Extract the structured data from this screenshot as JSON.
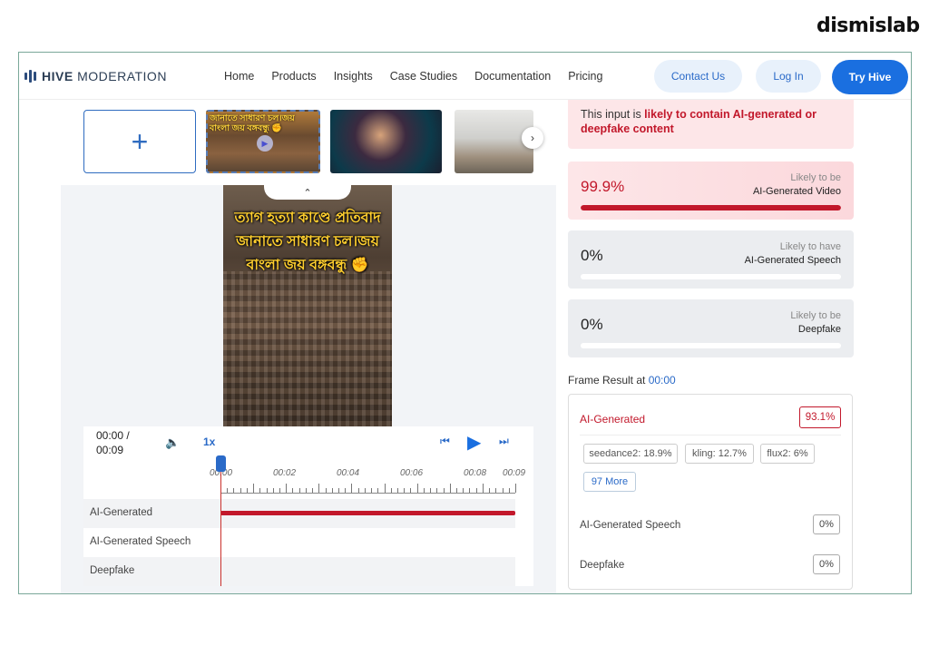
{
  "watermark": "dismislab",
  "brand": {
    "bold": "HIVE",
    "rest": " MODERATION"
  },
  "nav": {
    "links": [
      "Home",
      "Products",
      "Insights",
      "Case Studies",
      "Documentation",
      "Pricing"
    ],
    "contact": "Contact Us",
    "login": "Log In",
    "try": "Try Hive"
  },
  "gallery": {
    "add_symbol": "+",
    "thumb1_caption": "জানাতে সাধারণ চল।জয় বাংলা জয় বঙ্গবন্ধু ✊",
    "video_caption": "ত্যাগ হত্যা কাণ্ডে প্রতিবাদ জানাতে সাধারণ চল।জয় বাংলা জয় বঙ্গবন্ধু ✊",
    "collapse": "⌃",
    "next": "›"
  },
  "player": {
    "time_current": "00:00 /",
    "time_total": "00:09",
    "speed": "1x",
    "timeline_labels": [
      "00:00",
      "00:02",
      "00:04",
      "00:06",
      "00:08",
      "00:09"
    ],
    "tracks": [
      "AI-Generated",
      "AI-Generated Speech",
      "Deepfake"
    ]
  },
  "verdict": {
    "prefix": "This input is ",
    "highlight": "likely to contain AI-generated or deepfake content"
  },
  "cards": [
    {
      "pct": "99.9%",
      "lbl1": "Likely to be",
      "lbl2": "AI-Generated Video",
      "fill": 99.9
    },
    {
      "pct": "0%",
      "lbl1": "Likely to have",
      "lbl2": "AI-Generated Speech",
      "fill": 0
    },
    {
      "pct": "0%",
      "lbl1": "Likely to be",
      "lbl2": "Deepfake",
      "fill": 0
    }
  ],
  "frame_result": {
    "label": "Frame Result at ",
    "time": "00:00",
    "title": "AI-Generated",
    "score": "93.1%",
    "chips": [
      "seedance2: 18.9%",
      "kling: 12.7%",
      "flux2: 6%"
    ],
    "more": "97 More",
    "speech_label": "AI-Generated Speech",
    "speech_score": "0%",
    "deepfake_label": "Deepfake",
    "deepfake_score": "0%"
  },
  "colors": {
    "accent": "#1a6fe0",
    "alert": "#c2182b"
  }
}
